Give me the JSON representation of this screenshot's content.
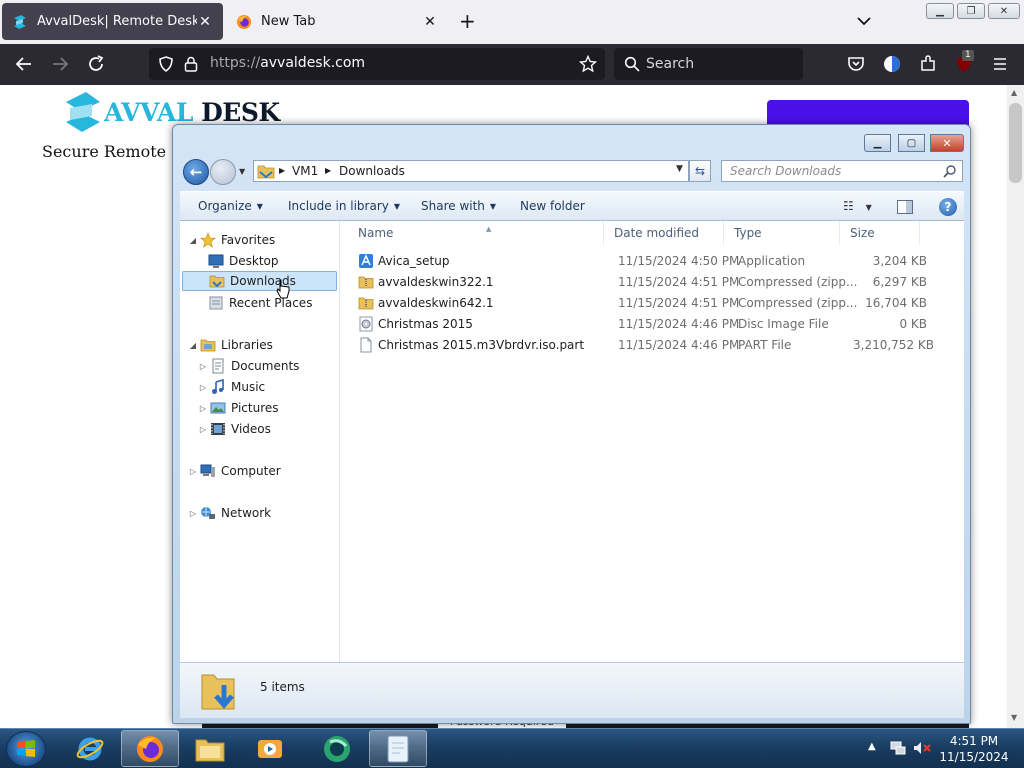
{
  "browser": {
    "tabs": [
      {
        "title": "AvvalDesk| Remote Desktop",
        "active": true
      },
      {
        "title": "New Tab",
        "active": false
      }
    ],
    "url_scheme": "https://",
    "url_host": "avvaldesk.com",
    "search_placeholder": "Search",
    "extension_badge": "1"
  },
  "page": {
    "logo_part1": "AVVAL",
    "logo_part2": "DESK",
    "tagline": "Secure Remote Co",
    "behind_text": "Password Required",
    "colors": {
      "brand_cyan": "#27b6dc",
      "button_purple": "#4a10e8"
    }
  },
  "explorer": {
    "breadcrumb": [
      "VM1",
      "Downloads"
    ],
    "search_placeholder": "Search Downloads",
    "commands": {
      "organize": "Organize",
      "include_in_library": "Include in library",
      "share_with": "Share with",
      "new_folder": "New folder"
    },
    "nav": {
      "favorites": "Favorites",
      "desktop": "Desktop",
      "downloads": "Downloads",
      "recent_places": "Recent Places",
      "libraries": "Libraries",
      "documents": "Documents",
      "music": "Music",
      "pictures": "Pictures",
      "videos": "Videos",
      "computer": "Computer",
      "network": "Network"
    },
    "columns": {
      "name": "Name",
      "date": "Date modified",
      "type": "Type",
      "size": "Size"
    },
    "files": [
      {
        "name": "Avica_setup",
        "date": "11/15/2024 4:50 PM",
        "type": "Application",
        "size": "3,204 KB",
        "icon": "application-icon"
      },
      {
        "name": "avvaldeskwin322.1",
        "date": "11/15/2024 4:51 PM",
        "type": "Compressed (zipp...",
        "size": "6,297 KB",
        "icon": "zip-folder-icon"
      },
      {
        "name": "avvaldeskwin642.1",
        "date": "11/15/2024 4:51 PM",
        "type": "Compressed (zipp...",
        "size": "16,704 KB",
        "icon": "zip-folder-icon"
      },
      {
        "name": "Christmas 2015",
        "date": "11/15/2024 4:46 PM",
        "type": "Disc Image File",
        "size": "0 KB",
        "icon": "disc-image-icon"
      },
      {
        "name": "Christmas 2015.m3Vbrdvr.iso.part",
        "date": "11/15/2024 4:46 PM",
        "type": "PART File",
        "size": "3,210,752 KB",
        "icon": "file-icon"
      }
    ],
    "item_count": "5 items"
  },
  "taskbar": {
    "time": "4:51 PM",
    "date": "11/15/2024"
  }
}
